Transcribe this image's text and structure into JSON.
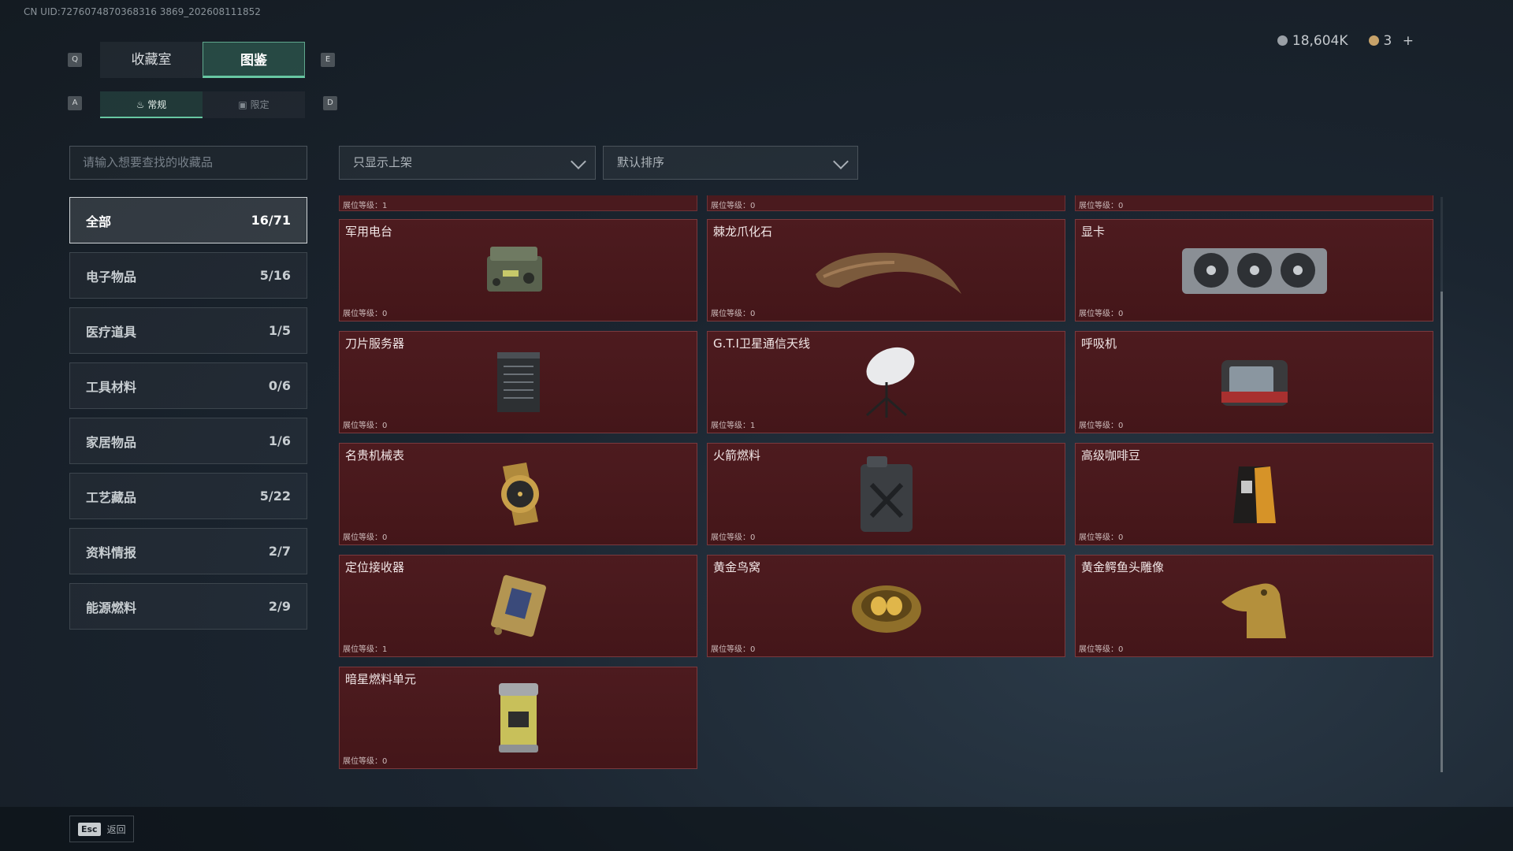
{
  "uid": "CN UID:7276074870368316 3869_202608111852",
  "keys": {
    "q": "Q",
    "e": "E",
    "a": "A",
    "d": "D"
  },
  "tabs": [
    {
      "label": "收藏室"
    },
    {
      "label": "图鉴"
    }
  ],
  "subtabs": [
    {
      "label": "常规"
    },
    {
      "label": "限定"
    }
  ],
  "currency": {
    "silver": "18,604K",
    "gold": "3",
    "plus": "+"
  },
  "search": {
    "placeholder": "请输入想要查找的收藏品"
  },
  "filters": {
    "shelf": "只显示上架",
    "sort": "默认排序"
  },
  "categories": [
    {
      "label": "全部",
      "count": "16/71"
    },
    {
      "label": "电子物品",
      "count": "5/16"
    },
    {
      "label": "医疗道具",
      "count": "1/5"
    },
    {
      "label": "工具材料",
      "count": "0/6"
    },
    {
      "label": "家居物品",
      "count": "1/6"
    },
    {
      "label": "工艺藏品",
      "count": "5/22"
    },
    {
      "label": "资料情报",
      "count": "2/7"
    },
    {
      "label": "能源燃料",
      "count": "2/9"
    }
  ],
  "partial_row": [
    {
      "level": "展位等级：1"
    },
    {
      "level": "展位等级：0"
    },
    {
      "level": "展位等级：0"
    }
  ],
  "items": [
    {
      "name": "军用电台",
      "level": "展位等级：0",
      "icon": "radio-icon"
    },
    {
      "name": "棘龙爪化石",
      "level": "展位等级：0",
      "icon": "claw-fossil-icon"
    },
    {
      "name": "显卡",
      "level": "展位等级：0",
      "icon": "graphics-card-icon"
    },
    {
      "name": "刀片服务器",
      "level": "展位等级：0",
      "icon": "server-icon"
    },
    {
      "name": "G.T.I卫星通信天线",
      "level": "展位等级：1",
      "icon": "satellite-dish-icon"
    },
    {
      "name": "呼吸机",
      "level": "展位等级：0",
      "icon": "ventilator-icon"
    },
    {
      "name": "名贵机械表",
      "level": "展位等级：0",
      "icon": "watch-icon"
    },
    {
      "name": "火箭燃料",
      "level": "展位等级：0",
      "icon": "fuel-can-icon"
    },
    {
      "name": "高级咖啡豆",
      "level": "展位等级：0",
      "icon": "coffee-bag-icon"
    },
    {
      "name": "定位接收器",
      "level": "展位等级：1",
      "icon": "gps-receiver-icon"
    },
    {
      "name": "黄金鸟窝",
      "level": "展位等级：0",
      "icon": "golden-nest-icon"
    },
    {
      "name": "黄金鳄鱼头雕像",
      "level": "展位等级：0",
      "icon": "croc-statue-icon"
    },
    {
      "name": "暗星燃料单元",
      "level": "展位等级：0",
      "icon": "fuel-cell-icon"
    }
  ],
  "footer": {
    "esc_key": "Esc",
    "esc_label": "返回"
  },
  "colors": {
    "accent": "#67c7a2",
    "card_bg": "#4d1b1f",
    "card_border": "#7a3a3e"
  }
}
